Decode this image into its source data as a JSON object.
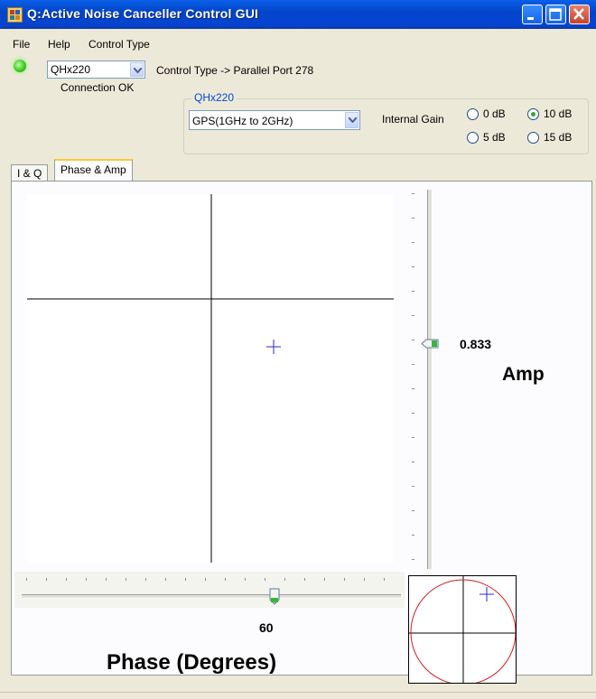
{
  "window": {
    "title": "Q:Active Noise Canceller Control GUI",
    "minimize_glyph": "_",
    "maximize_glyph": "□",
    "close_glyph": "X"
  },
  "menu": {
    "items": [
      "File",
      "Help",
      "Control Type"
    ]
  },
  "device": {
    "selected": "QHx220",
    "control_type_text": "Control Type -> Parallel Port 278",
    "connection_status": "Connection OK",
    "led_color": "#3cc21e"
  },
  "qhx220_group": {
    "title": "QHx220",
    "band_selected": "GPS(1GHz to 2GHz)",
    "internal_gain_label": "Internal Gain",
    "gain_options": [
      {
        "label": "0 dB",
        "checked": false
      },
      {
        "label": "10 dB",
        "checked": true
      },
      {
        "label": "5 dB",
        "checked": false
      },
      {
        "label": "15 dB",
        "checked": false
      }
    ]
  },
  "tabs": [
    {
      "label": "I & Q",
      "active": false
    },
    {
      "label": "Phase & Amp",
      "active": true
    }
  ],
  "amp": {
    "value": "0.833",
    "title": "Amp"
  },
  "phase": {
    "value": "60",
    "title": "Phase (Degrees)"
  },
  "colors": {
    "titlebar": "#0a5fe6",
    "marker": "#2a2ad0",
    "polar_circle": "#cc2020"
  },
  "icons": {
    "window_icon": "app-icon",
    "dropdown": "chevron-down-icon"
  }
}
